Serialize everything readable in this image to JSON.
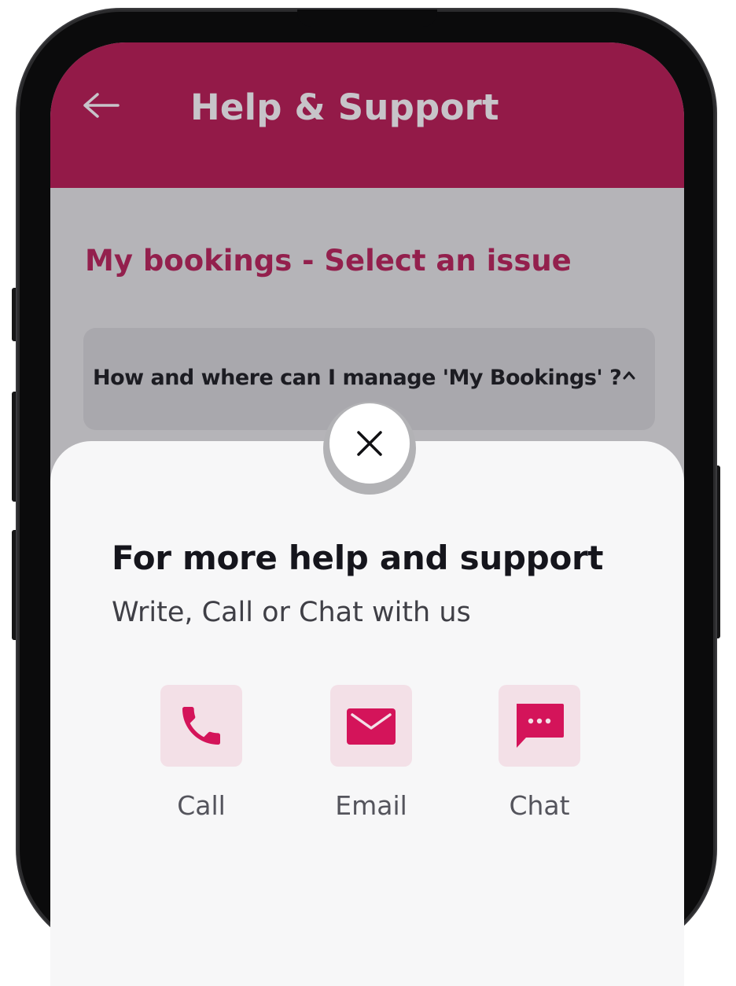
{
  "header": {
    "title": "Help & Support",
    "back_icon": "arrow-left-icon"
  },
  "content": {
    "section_title": "My bookings - Select an issue",
    "faq": {
      "question": "How and where can I manage 'My Bookings' ?",
      "state_icon": "caret-up-icon"
    }
  },
  "sheet": {
    "close_icon": "close-icon",
    "title": "For more help and support",
    "subtitle": "Write, Call or Chat with us",
    "options": [
      {
        "label": "Call",
        "icon": "phone-icon"
      },
      {
        "label": "Email",
        "icon": "mail-icon"
      },
      {
        "label": "Chat",
        "icon": "chat-icon"
      }
    ]
  },
  "colors": {
    "brand": "#931a48",
    "accent": "#d4145a",
    "icon_tile": "#f3e0e7",
    "overlay": "#b5b4b8",
    "sheet": "#f7f7f8"
  }
}
